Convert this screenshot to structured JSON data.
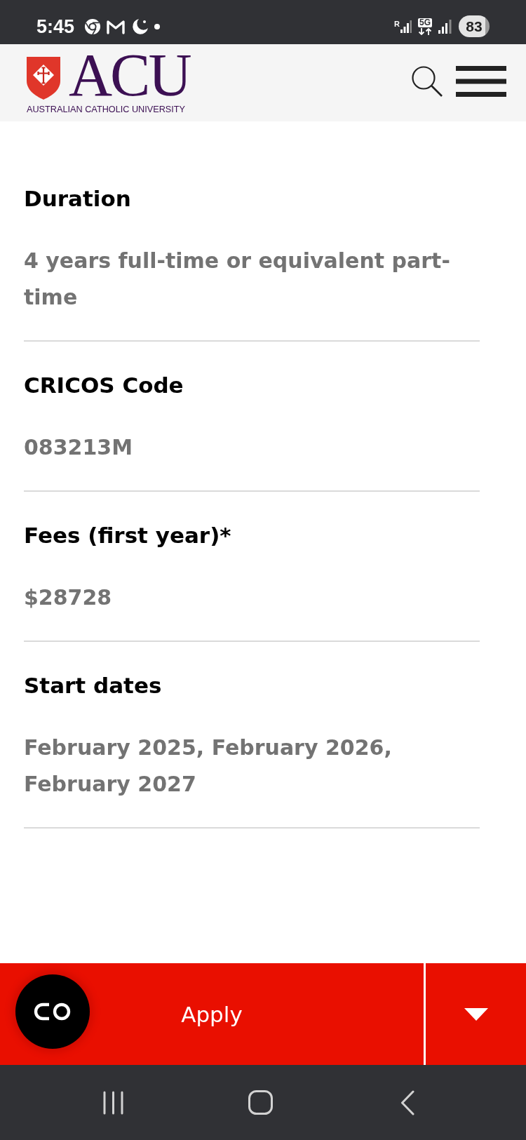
{
  "status_bar": {
    "time": "5:45",
    "roaming": "R",
    "network": "5G",
    "battery": "83"
  },
  "header": {
    "logo_text": "ACU",
    "logo_subtitle": "AUSTRALIAN CATHOLIC UNIVERSITY"
  },
  "details": [
    {
      "label": "Duration",
      "value": "4 years full-time or equivalent part-time"
    },
    {
      "label": "CRICOS Code",
      "value": "083213M"
    },
    {
      "label": "Fees (first year)*",
      "value": "$28728"
    },
    {
      "label": "Start dates",
      "value": "February 2025, February 2026, February 2027"
    }
  ],
  "action_bar": {
    "button": "Apply"
  }
}
